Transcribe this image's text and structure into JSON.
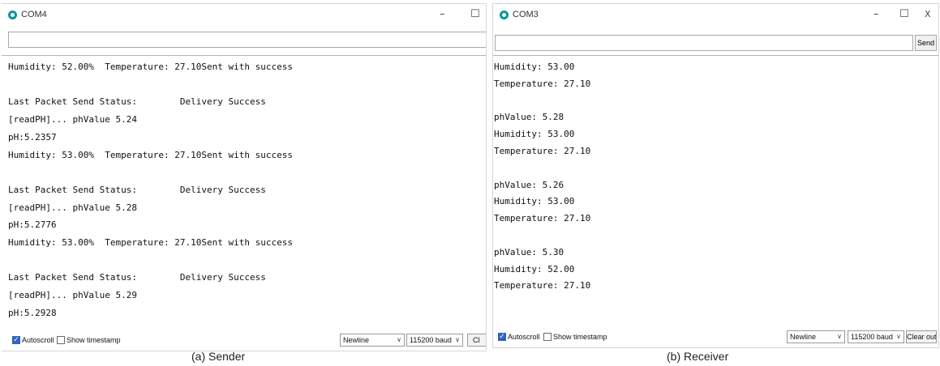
{
  "sender": {
    "title": "COM4",
    "controls": {
      "minimize": "–",
      "maximize": "☐"
    },
    "send_input_value": "",
    "output_lines": [
      "Humidity: 52.00%  Temperature: 27.10Sent with success",
      "",
      "Last Packet Send Status:        Delivery Success",
      "[readPH]... phValue 5.24",
      "pH:5.2357",
      "Humidity: 53.00%  Temperature: 27.10Sent with success",
      "",
      "Last Packet Send Status:        Delivery Success",
      "[readPH]... phValue 5.28",
      "pH:5.2776",
      "Humidity: 53.00%  Temperature: 27.10Sent with success",
      "",
      "Last Packet Send Status:        Delivery Success",
      "[readPH]... phValue 5.29",
      "pH:5.2928"
    ],
    "bottom": {
      "autoscroll_label": "Autoscroll",
      "autoscroll_checked": true,
      "timestamp_label": "Show timestamp",
      "timestamp_checked": false,
      "line_ending": "Newline",
      "baud": "115200 baud",
      "clear_label": "Cl"
    },
    "caption": "(a) Sender"
  },
  "receiver": {
    "title": "COM3",
    "controls": {
      "minimize": "–",
      "maximize": "☐",
      "close": "X"
    },
    "send_input_value": "",
    "send_label": "Send",
    "output_lines": [
      "Humidity: 53.00",
      "Temperature: 27.10",
      "",
      "phValue: 5.28",
      "Humidity: 53.00",
      "Temperature: 27.10",
      "",
      "phValue: 5.26",
      "Humidity: 53.00",
      "Temperature: 27.10",
      "",
      "phValue: 5.30",
      "Humidity: 52.00",
      "Temperature: 27.10"
    ],
    "bottom": {
      "autoscroll_label": "Autoscroll",
      "autoscroll_checked": true,
      "timestamp_label": "Show timestamp",
      "timestamp_checked": false,
      "line_ending": "Newline",
      "baud": "115200 baud",
      "clear_label": "Clear output"
    },
    "caption": "(b) Receiver"
  },
  "colors": {
    "accent": "#00979c",
    "checkbox": "#2f64c0"
  }
}
